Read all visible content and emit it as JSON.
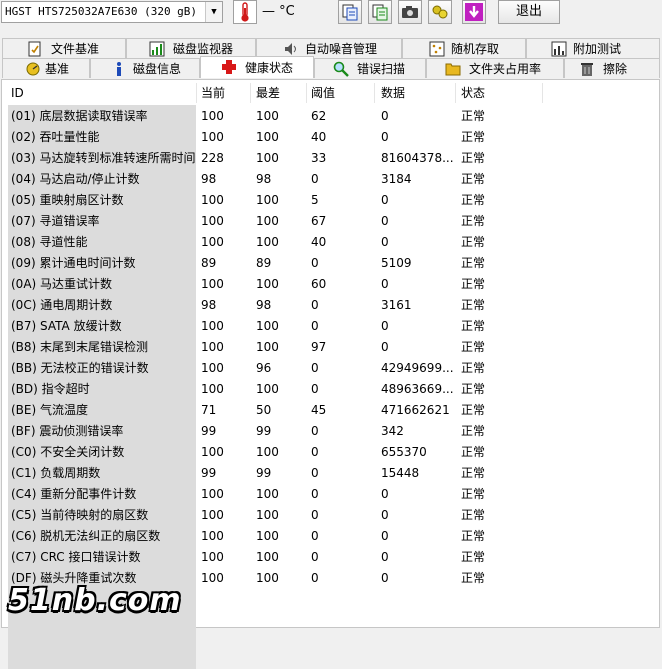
{
  "toolbar": {
    "drive": "HGST HTS725032A7E630 (320 gB)",
    "temperature": "— °C",
    "exit_label": "退出",
    "buttons": [
      "copy-icon",
      "copy-all-icon",
      "camera-icon",
      "refresh-icon",
      "save-icon"
    ],
    "colors": {
      "thermometer": "#d01818",
      "save": "#c020c0"
    }
  },
  "tabs_row1": [
    {
      "label": "文件基准",
      "icon": "file-benchmark-icon"
    },
    {
      "label": "磁盘监视器",
      "icon": "monitor-chart-icon"
    },
    {
      "label": "自动噪音管理",
      "icon": "speaker-icon"
    },
    {
      "label": "随机存取",
      "icon": "random-access-icon"
    },
    {
      "label": "附加测试",
      "icon": "extra-test-icon"
    }
  ],
  "tabs_row2": [
    {
      "label": "基准",
      "icon": "benchmark-icon"
    },
    {
      "label": "磁盘信息",
      "icon": "info-icon"
    },
    {
      "label": "健康状态",
      "icon": "health-cross-icon",
      "active": true
    },
    {
      "label": "错误扫描",
      "icon": "magnifier-icon"
    },
    {
      "label": "文件夹占用率",
      "icon": "folder-icon"
    },
    {
      "label": "擦除",
      "icon": "trash-icon"
    }
  ],
  "table": {
    "headers": [
      "ID",
      "当前",
      "最差",
      "阈值",
      "数据",
      "状态"
    ],
    "rows": [
      [
        "(01) 底层数据读取错误率",
        "100",
        "100",
        "62",
        "0",
        "正常"
      ],
      [
        "(02) 吞吐量性能",
        "100",
        "100",
        "40",
        "0",
        "正常"
      ],
      [
        "(03) 马达旋转到标准转速所需时间",
        "228",
        "100",
        "33",
        "81604378...",
        "正常"
      ],
      [
        "(04) 马达启动/停止计数",
        "98",
        "98",
        "0",
        "3184",
        "正常"
      ],
      [
        "(05) 重映射扇区计数",
        "100",
        "100",
        "5",
        "0",
        "正常"
      ],
      [
        "(07) 寻道错误率",
        "100",
        "100",
        "67",
        "0",
        "正常"
      ],
      [
        "(08) 寻道性能",
        "100",
        "100",
        "40",
        "0",
        "正常"
      ],
      [
        "(09) 累计通电时间计数",
        "89",
        "89",
        "0",
        "5109",
        "正常"
      ],
      [
        "(0A) 马达重试计数",
        "100",
        "100",
        "60",
        "0",
        "正常"
      ],
      [
        "(0C) 通电周期计数",
        "98",
        "98",
        "0",
        "3161",
        "正常"
      ],
      [
        "(B7) SATA 放缓计数",
        "100",
        "100",
        "0",
        "0",
        "正常"
      ],
      [
        "(B8) 末尾到末尾错误检测",
        "100",
        "100",
        "97",
        "0",
        "正常"
      ],
      [
        "(BB) 无法校正的错误计数",
        "100",
        "96",
        "0",
        "42949699...",
        "正常"
      ],
      [
        "(BD) 指令超时",
        "100",
        "100",
        "0",
        "48963669...",
        "正常"
      ],
      [
        "(BE) 气流温度",
        "71",
        "50",
        "45",
        "471662621",
        "正常"
      ],
      [
        "(BF) 震动侦测错误率",
        "99",
        "99",
        "0",
        "342",
        "正常"
      ],
      [
        "(C0) 不安全关闭计数",
        "100",
        "100",
        "0",
        "655370",
        "正常"
      ],
      [
        "(C1) 负载周期数",
        "99",
        "99",
        "0",
        "15448",
        "正常"
      ],
      [
        "(C4) 重新分配事件计数",
        "100",
        "100",
        "0",
        "0",
        "正常"
      ],
      [
        "(C5) 当前待映射的扇区数",
        "100",
        "100",
        "0",
        "0",
        "正常"
      ],
      [
        "(C6) 脱机无法纠正的扇区数",
        "100",
        "100",
        "0",
        "0",
        "正常"
      ],
      [
        "(C7) CRC 接口错误计数",
        "100",
        "100",
        "0",
        "0",
        "正常"
      ],
      [
        "(DF) 磁头升降重试次数",
        "100",
        "100",
        "0",
        "0",
        "正常"
      ]
    ]
  },
  "watermark": "51nb.com"
}
